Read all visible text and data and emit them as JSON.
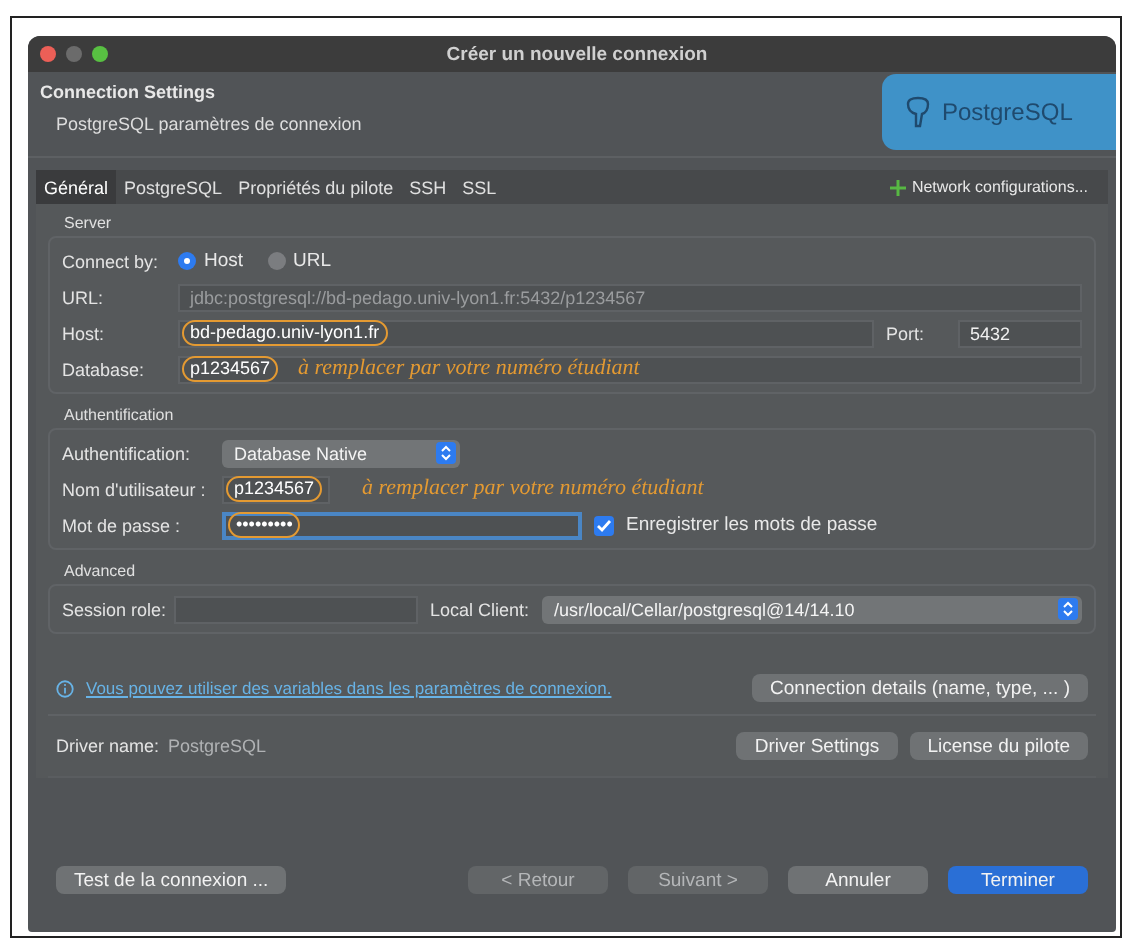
{
  "window": {
    "title": "Créer un nouvelle connexion"
  },
  "header": {
    "title": "Connection Settings",
    "subtitle": "PostgreSQL paramètres de connexion",
    "logo_text": "PostgreSQL"
  },
  "tabs": [
    {
      "label": "Général",
      "selected": true
    },
    {
      "label": "PostgreSQL",
      "selected": false
    },
    {
      "label": "Propriétés du pilote",
      "selected": false
    },
    {
      "label": "SSH",
      "selected": false
    },
    {
      "label": "SSL",
      "selected": false
    }
  ],
  "network_button": "Network configurations...",
  "server": {
    "title": "Server",
    "connect_by_label": "Connect by:",
    "connect_options": [
      {
        "label": "Host",
        "selected": true
      },
      {
        "label": "URL",
        "selected": false
      }
    ],
    "url_label": "URL:",
    "url_value": "jdbc:postgresql://bd-pedago.univ-lyon1.fr:5432/p1234567",
    "host_label": "Host:",
    "host_value": "bd-pedago.univ-lyon1.fr",
    "port_label": "Port:",
    "port_value": "5432",
    "database_label": "Database:",
    "database_value": "p1234567",
    "database_note": "à remplacer par votre numéro étudiant"
  },
  "auth": {
    "title": "Authentification",
    "method_label": "Authentification:",
    "method_value": "Database Native",
    "user_label": "Nom d'utilisateur :",
    "user_value": "p1234567",
    "user_note": "à remplacer par votre numéro étudiant",
    "password_label": "Mot de passe :",
    "password_value": "•••••••••",
    "save_password": {
      "label": "Enregistrer les mots de passe",
      "checked": true
    }
  },
  "advanced": {
    "title": "Advanced",
    "session_role_label": "Session role:",
    "local_client_label": "Local Client:",
    "local_client_value": "/usr/local/Cellar/postgresql@14/14.10"
  },
  "info_link": "Vous pouvez utiliser des variables dans les paramètres de connexion.",
  "connection_details_button": "Connection details (name, type, ... )",
  "driver": {
    "label": "Driver name:",
    "value": "PostgreSQL",
    "buttons": [
      "Driver Settings",
      "License du pilote"
    ]
  },
  "footer_buttons": [
    {
      "label": "Test de la connexion ...",
      "kind": "normal",
      "disabled": false
    },
    {
      "label": "< Retour",
      "kind": "normal",
      "disabled": true
    },
    {
      "label": "Suivant >",
      "kind": "normal",
      "disabled": true
    },
    {
      "label": "Annuler",
      "kind": "normal",
      "disabled": false
    },
    {
      "label": "Terminer",
      "kind": "primary",
      "disabled": false
    }
  ]
}
